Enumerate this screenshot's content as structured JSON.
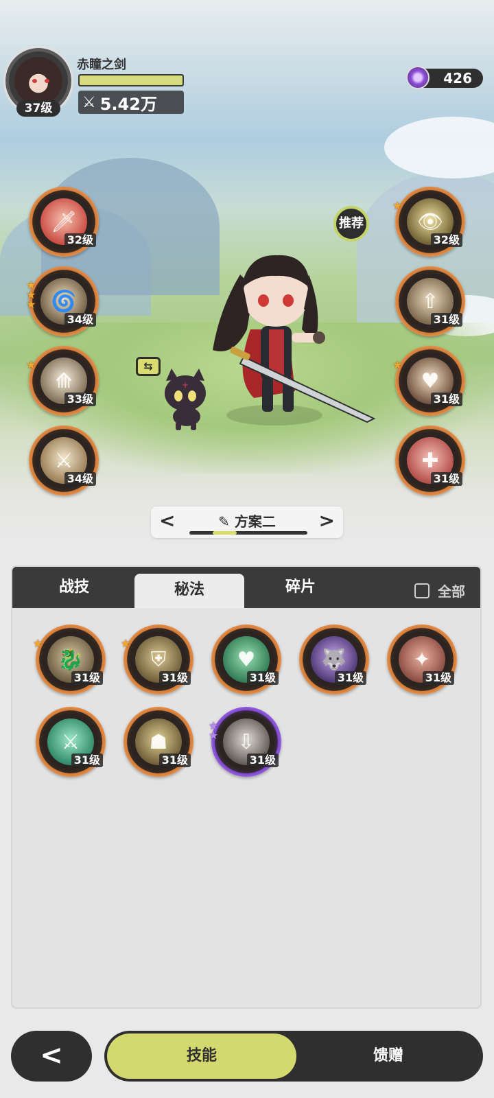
{
  "player": {
    "name": "赤瞳之剑",
    "level": "37级",
    "power": "5.42万",
    "hp_fill": 1.0
  },
  "currency": {
    "icon": "crystal-icon",
    "value": "426"
  },
  "left_skills": [
    {
      "icon": "raised-sword-icon",
      "level": "32级",
      "stars": 0
    },
    {
      "icon": "whirlwind-icon",
      "level": "34级",
      "stars": 3
    },
    {
      "icon": "spikes-icon",
      "level": "33级",
      "stars": 1
    },
    {
      "icon": "sword-strike-icon",
      "level": "34级",
      "stars": 0
    }
  ],
  "right_skills": [
    {
      "icon": "eye-icon",
      "level": "32级",
      "stars": 1
    },
    {
      "icon": "sword-up-icon",
      "level": "31级",
      "stars": 0
    },
    {
      "icon": "shield-heart-icon",
      "level": "31级",
      "stars": 1
    },
    {
      "icon": "sword-plus-icon",
      "level": "31级",
      "stars": 0
    }
  ],
  "recommend_label": "推荐",
  "plan": {
    "label": "方案二",
    "icon": "edit-icon",
    "position": 2,
    "count": 5
  },
  "tabs": {
    "combat": "战技",
    "secret": "秘法",
    "fragments": "碎片",
    "all": "全部"
  },
  "secret_skills": [
    {
      "icon": "dragon-icon",
      "level": "31级",
      "stars": 1,
      "rarity": "orange"
    },
    {
      "icon": "armor-icon",
      "level": "31级",
      "stars": 1,
      "rarity": "orange"
    },
    {
      "icon": "heart-plus-icon",
      "level": "31级",
      "stars": 0,
      "rarity": "orange"
    },
    {
      "icon": "shadow-beast-icon",
      "level": "31级",
      "stars": 0,
      "rarity": "orange"
    },
    {
      "icon": "slash-icon",
      "level": "31级",
      "stars": 0,
      "rarity": "orange"
    },
    {
      "icon": "green-sword-icon",
      "level": "31级",
      "stars": 0,
      "rarity": "orange"
    },
    {
      "icon": "warriors-icon",
      "level": "31级",
      "stars": 0,
      "rarity": "orange"
    },
    {
      "icon": "sword-down-icon",
      "level": "31级",
      "stars": 2,
      "rarity": "purple"
    }
  ],
  "bottom": {
    "skills": "技能",
    "gifts": "馈赠"
  }
}
